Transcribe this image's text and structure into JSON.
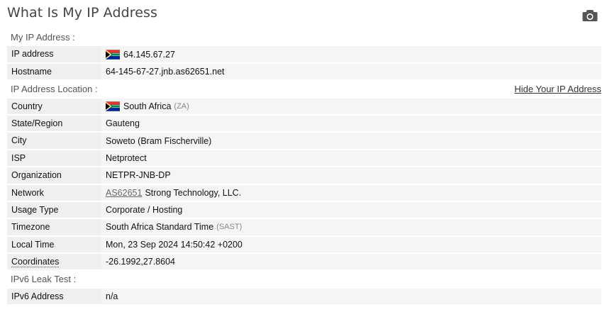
{
  "page": {
    "title": "What Is My IP Address"
  },
  "sections": {
    "ip": {
      "label": "My IP Address :"
    },
    "location": {
      "label": "IP Address Location :",
      "hide_link": "Hide Your IP Address"
    },
    "ipv6": {
      "label": "IPv6 Leak Test :"
    }
  },
  "ip_rows": {
    "ip_address": {
      "label": "IP address",
      "value": "64.145.67.27"
    },
    "hostname": {
      "label": "Hostname",
      "value": "64-145-67-27.jnb.as62651.net"
    }
  },
  "location_rows": {
    "country": {
      "label": "Country",
      "value": "South Africa",
      "code": "(ZA)"
    },
    "state": {
      "label": "State/Region",
      "value": "Gauteng"
    },
    "city": {
      "label": "City",
      "value": "Soweto (Bram Fischerville)"
    },
    "isp": {
      "label": "ISP",
      "value": "Netprotect"
    },
    "organization": {
      "label": "Organization",
      "value": "NETPR-JNB-DP"
    },
    "network": {
      "label": "Network",
      "asn": "AS62651",
      "value": "Strong Technology, LLC."
    },
    "usage_type": {
      "label": "Usage Type",
      "value": "Corporate / Hosting"
    },
    "timezone": {
      "label": "Timezone",
      "value": "South Africa Standard Time",
      "code": "(SAST)"
    },
    "local_time": {
      "label": "Local Time",
      "value": "Mon, 23 Sep 2024 14:50:42 +0200"
    },
    "coordinates": {
      "label": "Coordinates",
      "value": "-26.1992,27.8604"
    }
  },
  "ipv6_rows": {
    "ipv6_address": {
      "label": "IPv6 Address",
      "value": "n/a"
    }
  },
  "icons": {
    "camera": "camera-icon",
    "flag": "south-africa-flag-icon"
  },
  "colors": {
    "label_bg": "#efefef",
    "value_bg": "#f5f5f5",
    "title": "#444444"
  }
}
